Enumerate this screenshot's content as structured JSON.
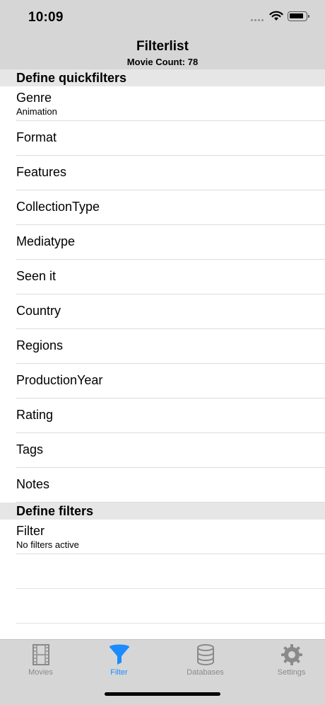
{
  "status_bar": {
    "time": "10:09"
  },
  "nav": {
    "title": "Filterlist",
    "subtitle": "Movie Count: 78"
  },
  "sections": {
    "quickfilters_header": "Define quickfilters",
    "filters_header": "Define filters"
  },
  "quickfilters": [
    {
      "label": "Genre",
      "value": "Animation"
    },
    {
      "label": "Format"
    },
    {
      "label": "Features"
    },
    {
      "label": "CollectionType"
    },
    {
      "label": "Mediatype"
    },
    {
      "label": "Seen it"
    },
    {
      "label": "Country"
    },
    {
      "label": "Regions"
    },
    {
      "label": "ProductionYear"
    },
    {
      "label": "Rating"
    },
    {
      "label": "Tags"
    },
    {
      "label": "Notes"
    }
  ],
  "filters": [
    {
      "label": "Filter",
      "value": "No filters active"
    }
  ],
  "tab_bar": {
    "accent_color": "#1a8cff",
    "inactive_color": "#8a8a8a",
    "tabs": [
      {
        "label": "Movies",
        "icon": "film-icon",
        "active": false
      },
      {
        "label": "Filter",
        "icon": "funnel-icon",
        "active": true
      },
      {
        "label": "Databases",
        "icon": "database-icon",
        "active": false
      },
      {
        "label": "Settings",
        "icon": "gear-icon",
        "active": false
      }
    ]
  }
}
